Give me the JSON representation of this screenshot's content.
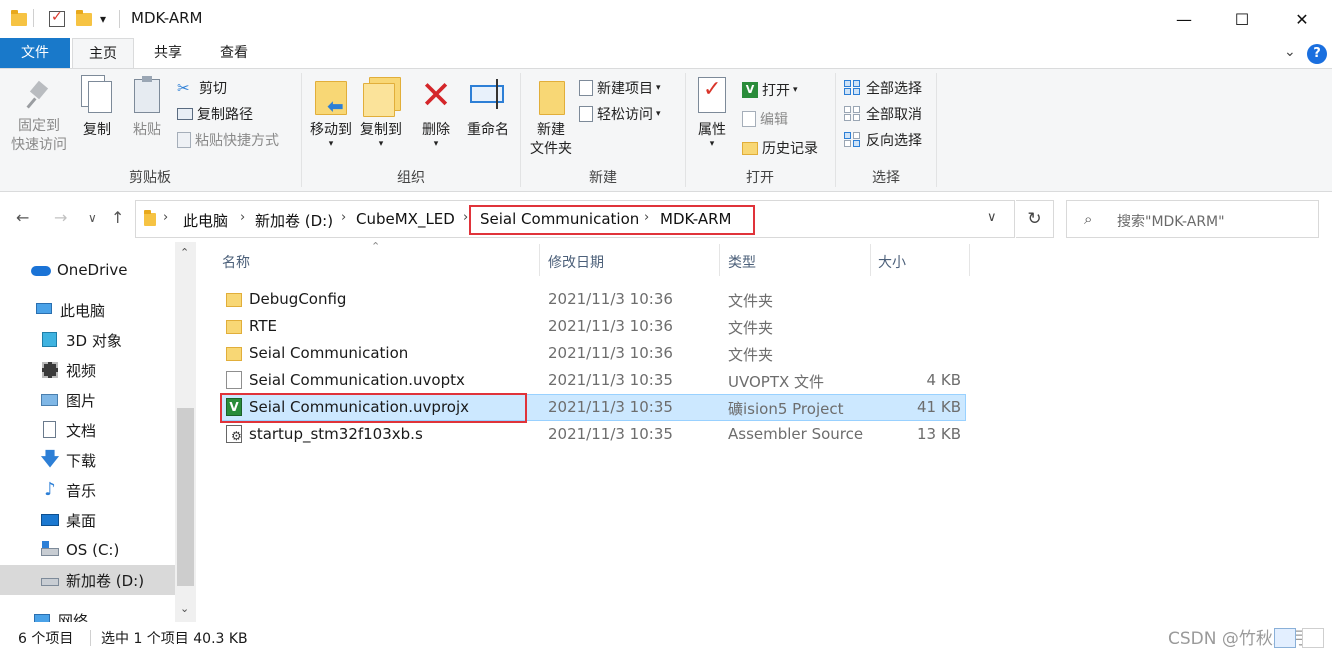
{
  "window": {
    "title": "MDK-ARM",
    "controls": {
      "minimize": "—",
      "maximize": "☐",
      "close": "✕"
    },
    "quick_access_dropdown": "▾"
  },
  "ribbon_tabs": {
    "file": "文件",
    "home": "主页",
    "share": "共享",
    "view": "查看",
    "collapse": "⌄",
    "help": "?"
  },
  "ribbon": {
    "clipboard": {
      "label": "剪贴板",
      "pin": {
        "line1": "固定到",
        "line2": "快速访问"
      },
      "copy": "复制",
      "paste": "粘贴",
      "cut": "剪切",
      "copy_path": "复制路径",
      "paste_shortcut": "粘贴快捷方式"
    },
    "organize": {
      "label": "组织",
      "move_to": "移动到",
      "copy_to": "复制到",
      "delete": "删除",
      "rename": "重命名"
    },
    "new": {
      "label": "新建",
      "new_folder": {
        "line1": "新建",
        "line2": "文件夹"
      },
      "new_item": "新建项目",
      "easy_access": "轻松访问"
    },
    "open": {
      "label": "打开",
      "properties": "属性",
      "open": "打开",
      "edit": "编辑",
      "history": "历史记录"
    },
    "select": {
      "label": "选择",
      "select_all": "全部选择",
      "select_none": "全部取消",
      "invert": "反向选择"
    }
  },
  "address": {
    "back": "←",
    "forward": "→",
    "recent": "∨",
    "up": "↑",
    "crumbs": [
      "此电脑",
      "新加卷 (D:)",
      "CubeMX_LED",
      "Seial Communication",
      "MDK-ARM"
    ],
    "separator": "›",
    "dropdown": "∨",
    "refresh": "↻"
  },
  "search": {
    "icon": "search-icon",
    "placeholder": "搜索\"MDK-ARM\""
  },
  "nav": {
    "items": [
      {
        "label": "OneDrive",
        "icon": "cloud-icon"
      },
      {
        "label": "此电脑",
        "icon": "computer-icon"
      },
      {
        "label": "3D 对象",
        "icon": "cube-icon"
      },
      {
        "label": "视频",
        "icon": "film-icon"
      },
      {
        "label": "图片",
        "icon": "picture-icon"
      },
      {
        "label": "文档",
        "icon": "document-icon"
      },
      {
        "label": "下载",
        "icon": "download-icon"
      },
      {
        "label": "音乐",
        "icon": "music-icon"
      },
      {
        "label": "桌面",
        "icon": "desktop-icon"
      },
      {
        "label": "OS (C:)",
        "icon": "drive-icon"
      },
      {
        "label": "新加卷 (D:)",
        "icon": "drive-icon"
      },
      {
        "label": "网络",
        "icon": "network-icon"
      }
    ],
    "selected": "新加卷 (D:)",
    "scroll_up": "⌃",
    "scroll_down": "⌄"
  },
  "columns": {
    "name": "名称",
    "modified": "修改日期",
    "type": "类型",
    "size": "大小",
    "sort_indicator": "⌃"
  },
  "files": [
    {
      "name": "DebugConfig",
      "modified": "2021/11/3 10:36",
      "type": "文件夹",
      "size": "",
      "icon": "folder-icon"
    },
    {
      "name": "RTE",
      "modified": "2021/11/3 10:36",
      "type": "文件夹",
      "size": "",
      "icon": "folder-icon"
    },
    {
      "name": "Seial Communication",
      "modified": "2021/11/3 10:36",
      "type": "文件夹",
      "size": "",
      "icon": "folder-icon"
    },
    {
      "name": "Seial Communication.uvoptx",
      "modified": "2021/11/3 10:35",
      "type": "UVOPTX 文件",
      "size": "4 KB",
      "icon": "blank-file-icon"
    },
    {
      "name": "Seial Communication.uvprojx",
      "modified": "2021/11/3 10:35",
      "type": "礦ision5 Project",
      "size": "41 KB",
      "icon": "uvision-icon",
      "uv_glyph": "V"
    },
    {
      "name": "startup_stm32f103xb.s",
      "modified": "2021/11/3 10:35",
      "type": "Assembler Source",
      "size": "13 KB",
      "icon": "assembler-file-icon"
    }
  ],
  "status": {
    "count": "6 个项目",
    "selection": "选中 1 个项目  40.3 KB"
  },
  "watermark": "CSDN @竹秋五月",
  "colors": {
    "accent": "#1979ca",
    "selection": "#cce8ff",
    "highlight_box": "#e0333a"
  }
}
